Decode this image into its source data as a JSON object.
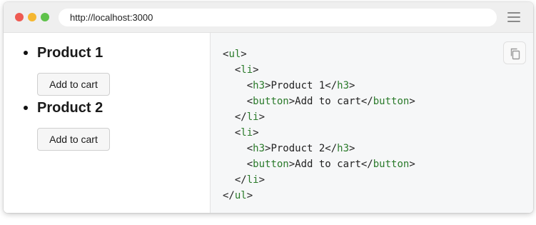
{
  "browser": {
    "url": "http://localhost:3000",
    "traffic_lights": {
      "close": "#ee5a52",
      "minimize": "#f5b731",
      "maximize": "#5fc24b"
    },
    "menu_icon": "hamburger-menu-icon"
  },
  "preview": {
    "products": [
      {
        "title": "Product 1",
        "button_label": "Add to cart"
      },
      {
        "title": "Product 2",
        "button_label": "Add to cart"
      }
    ]
  },
  "code_panel": {
    "copy_icon": "copy-icon",
    "tag_color": "#2a7a2a",
    "lines": [
      {
        "indent": 0,
        "parts": [
          {
            "t": "<",
            "tag": false
          },
          {
            "t": "ul",
            "tag": true
          },
          {
            "t": ">",
            "tag": false
          }
        ]
      },
      {
        "indent": 1,
        "parts": [
          {
            "t": "<",
            "tag": false
          },
          {
            "t": "li",
            "tag": true
          },
          {
            "t": ">",
            "tag": false
          }
        ]
      },
      {
        "indent": 2,
        "parts": [
          {
            "t": "<",
            "tag": false
          },
          {
            "t": "h3",
            "tag": true
          },
          {
            "t": ">Product 1</",
            "tag": false
          },
          {
            "t": "h3",
            "tag": true
          },
          {
            "t": ">",
            "tag": false
          }
        ]
      },
      {
        "indent": 2,
        "parts": [
          {
            "t": "<",
            "tag": false
          },
          {
            "t": "button",
            "tag": true
          },
          {
            "t": ">Add to cart</",
            "tag": false
          },
          {
            "t": "button",
            "tag": true
          },
          {
            "t": ">",
            "tag": false
          }
        ]
      },
      {
        "indent": 1,
        "parts": [
          {
            "t": "</",
            "tag": false
          },
          {
            "t": "li",
            "tag": true
          },
          {
            "t": ">",
            "tag": false
          }
        ]
      },
      {
        "indent": 1,
        "parts": [
          {
            "t": "<",
            "tag": false
          },
          {
            "t": "li",
            "tag": true
          },
          {
            "t": ">",
            "tag": false
          }
        ]
      },
      {
        "indent": 2,
        "parts": [
          {
            "t": "<",
            "tag": false
          },
          {
            "t": "h3",
            "tag": true
          },
          {
            "t": ">Product 2</",
            "tag": false
          },
          {
            "t": "h3",
            "tag": true
          },
          {
            "t": ">",
            "tag": false
          }
        ]
      },
      {
        "indent": 2,
        "parts": [
          {
            "t": "<",
            "tag": false
          },
          {
            "t": "button",
            "tag": true
          },
          {
            "t": ">Add to cart</",
            "tag": false
          },
          {
            "t": "button",
            "tag": true
          },
          {
            "t": ">",
            "tag": false
          }
        ]
      },
      {
        "indent": 1,
        "parts": [
          {
            "t": "</",
            "tag": false
          },
          {
            "t": "li",
            "tag": true
          },
          {
            "t": ">",
            "tag": false
          }
        ]
      },
      {
        "indent": 0,
        "parts": [
          {
            "t": "</",
            "tag": false
          },
          {
            "t": "ul",
            "tag": true
          },
          {
            "t": ">",
            "tag": false
          }
        ]
      }
    ]
  }
}
